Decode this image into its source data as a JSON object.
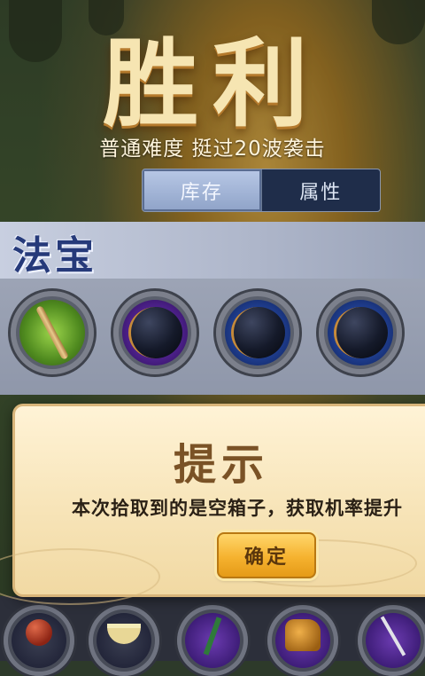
{
  "header": {
    "title": "胜利",
    "subtitle": "普通难度  挺过20波袭击"
  },
  "tabs": [
    {
      "label": "库存",
      "active": true
    },
    {
      "label": "属性",
      "active": false
    }
  ],
  "sections": [
    {
      "title": "法宝"
    }
  ],
  "dialog": {
    "title": "提示",
    "message": "本次拾取到的是空箱子，获取机率提升",
    "confirm_label": "确定"
  },
  "colors": {
    "accent_gold": "#f5b22f",
    "section_title": "#263a7a",
    "dialog_bg": "#f7e4b8"
  }
}
